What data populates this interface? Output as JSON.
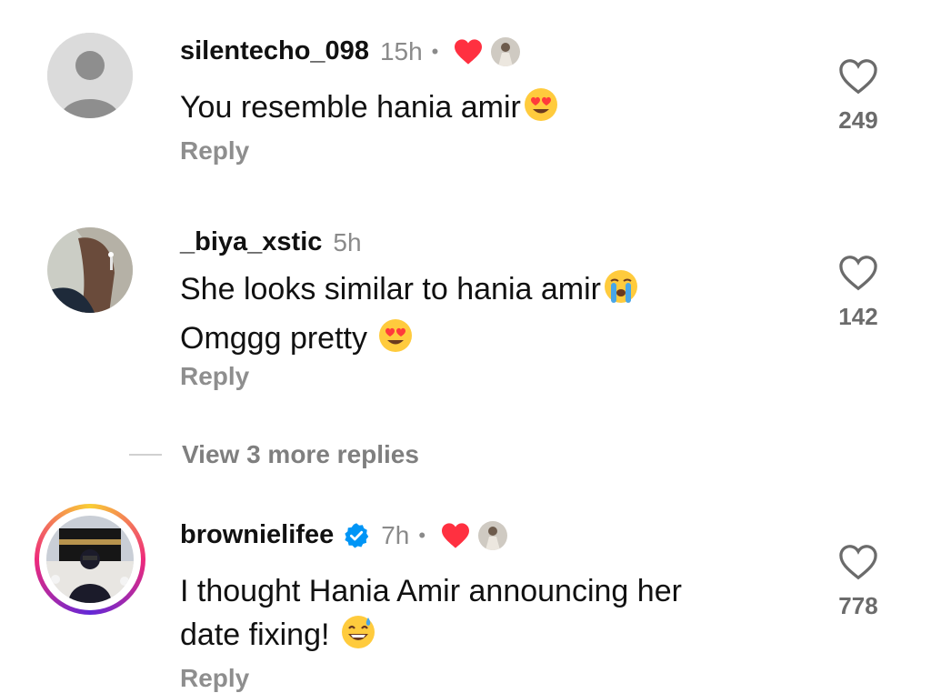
{
  "comments": [
    {
      "username": "silentecho_098",
      "time": "15h",
      "dot": "•",
      "text": "You resemble hania amir",
      "reply": "Reply",
      "likes": "249",
      "liked_by_creator": true
    },
    {
      "username": "_biya_xstic",
      "time": "5h",
      "text_line1": "She looks similar to hania amir",
      "text_line2": "Omggg pretty ",
      "reply": "Reply",
      "likes": "142"
    },
    {
      "username": "brownielifee",
      "verified": true,
      "time": "7h",
      "dot": "•",
      "text_line1": "I thought Hania Amir announcing her",
      "text_line2": "date fixing! ",
      "reply": "Reply",
      "likes": "778",
      "liked_by_creator": true
    }
  ],
  "view_more": "View 3 more replies",
  "colors": {
    "heart_red": "#ff3040",
    "verified_blue": "#0095f6",
    "meta_gray": "#8a8a8a",
    "story_ring": [
      "#f9ce34",
      "#ee2a7b",
      "#6228d7"
    ]
  },
  "icons": [
    "heart-outline-icon",
    "heart-filled-icon",
    "verified-badge-icon",
    "heart-eyes-emoji",
    "loudly-crying-emoji",
    "sweat-smile-emoji"
  ]
}
